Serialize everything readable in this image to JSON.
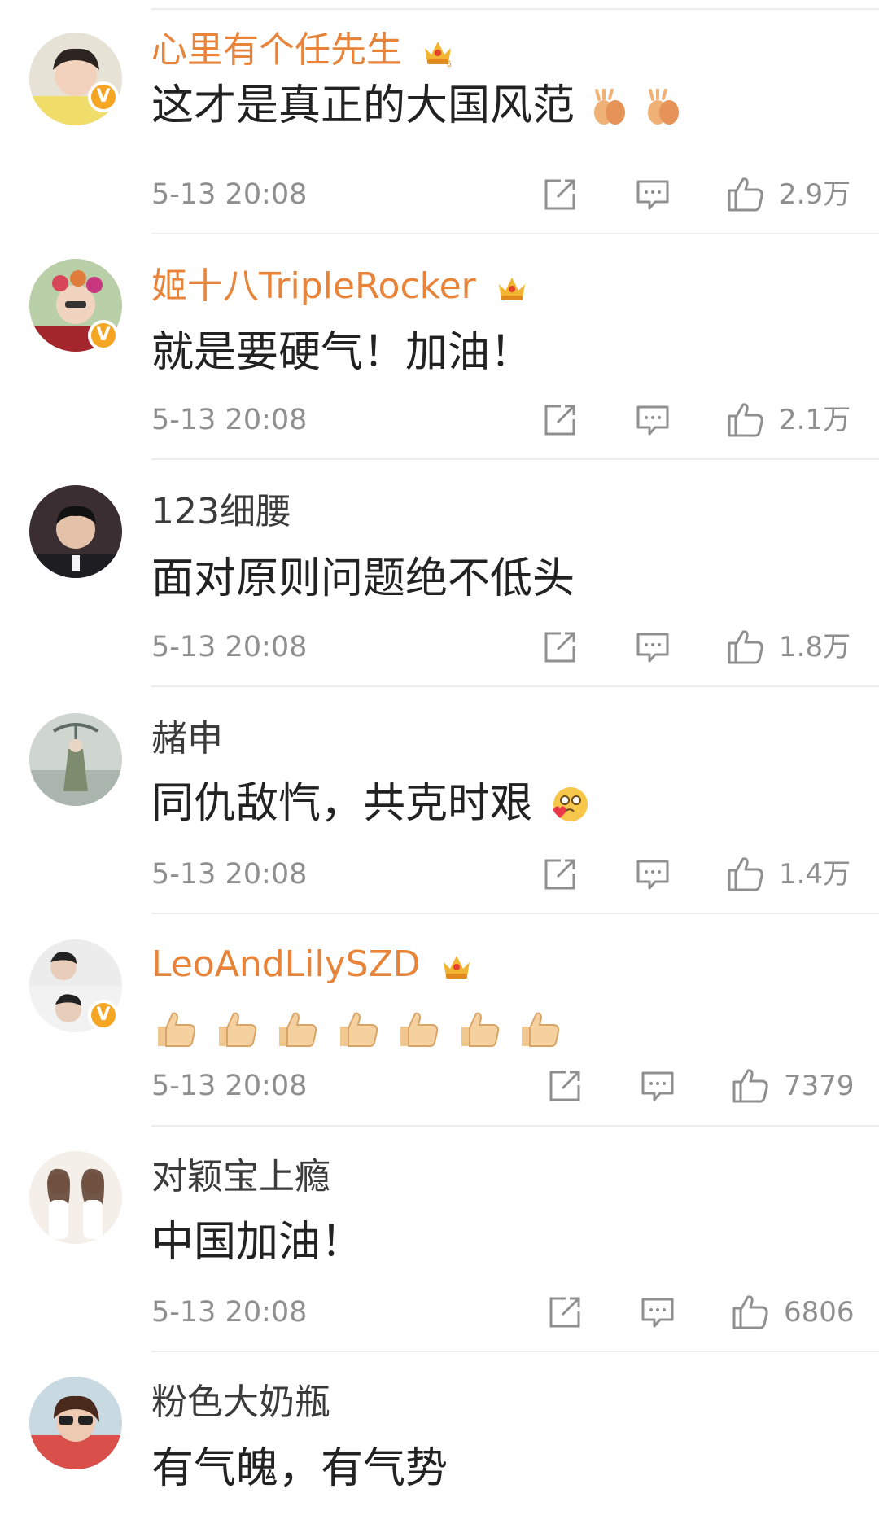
{
  "comments": [
    {
      "username": "心里有个任先生",
      "text": "这才是真正的大国风范",
      "time": "5-13 20:08",
      "likes": "2.9万",
      "vip": true,
      "verified": true,
      "emoji": "clapping-hands-emoji",
      "emoji_count": 2
    },
    {
      "username": "姬十八TripleRocker",
      "text": "就是要硬气！加油！",
      "time": "5-13 20:08",
      "likes": "2.1万",
      "vip": true,
      "verified": true
    },
    {
      "username": "123细腰",
      "text": "面对原则问题绝不低头",
      "time": "5-13 20:08",
      "likes": "1.8万",
      "vip": false,
      "verified": false
    },
    {
      "username": "赭申",
      "text": "同仇敌忾，共克时艰",
      "time": "5-13 20:08",
      "likes": "1.4万",
      "vip": false,
      "verified": false,
      "emoji": "blowing-kiss-emoji",
      "emoji_count": 1
    },
    {
      "username": "LeoAndLilySZD",
      "text": "",
      "time": "5-13 20:08",
      "likes": "7379",
      "vip": true,
      "verified": true,
      "emoji": "thumbs-up-emoji",
      "emoji_count": 7
    },
    {
      "username": "对颖宝上瘾",
      "text": "中国加油！",
      "time": "5-13 20:08",
      "likes": "6806",
      "vip": false,
      "verified": false
    },
    {
      "username": "粉色大奶瓶",
      "text": "有气魄，有气势",
      "time": "",
      "likes": "",
      "vip": false,
      "verified": false
    }
  ],
  "icons": {
    "share": "share-icon",
    "reply": "comment-icon",
    "like": "thumbs-up-icon",
    "crown": "vip-crown-icon",
    "verified": "verified-v-icon"
  },
  "colors": {
    "vip_name": "#e8833a",
    "plain_name": "#3b3b3b",
    "meta": "#8f8f8f",
    "badge": "#f5a623",
    "divider": "#ececec"
  }
}
